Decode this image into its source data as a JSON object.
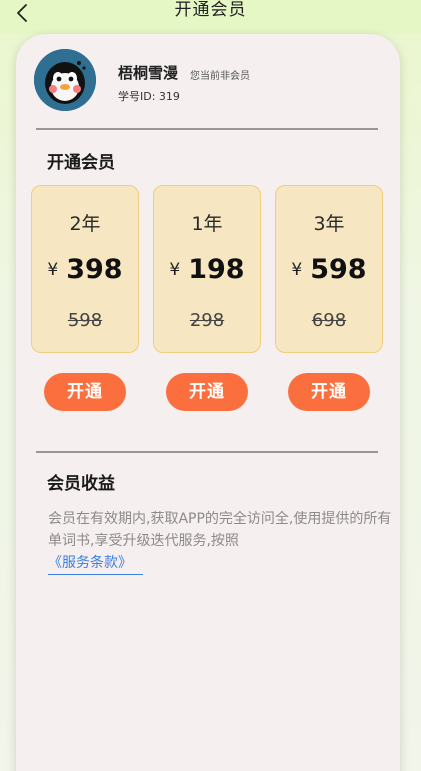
{
  "header": {
    "title": "开通会员",
    "back_icon": "chevron-left-icon"
  },
  "profile": {
    "username": "梧桐雪漫",
    "status": "您当前非会员",
    "student_id": "学号ID: 319",
    "avatar_icon": "penguin-avatar"
  },
  "plans_section": {
    "title": "开通会员",
    "currency": "¥",
    "plans": [
      {
        "duration": "2年",
        "price": "398",
        "original_price": "598",
        "button_label": "开通"
      },
      {
        "duration": "1年",
        "price": "198",
        "original_price": "298",
        "button_label": "开通"
      },
      {
        "duration": "3年",
        "price": "598",
        "original_price": "698",
        "button_label": "开通"
      }
    ]
  },
  "benefits": {
    "title": "会员收益",
    "description": "会员在有效期内,获取APP的完全访问全,使用提供的所有单词书,享受升级迭代服务,按照",
    "terms_link": "《服务条款》"
  },
  "colors": {
    "button": "#fb6f3e",
    "plan_card_bg": "#f7e6c2",
    "plan_card_border": "#f0cf7c",
    "link": "#3c7fe0",
    "header_bg": "#e6f7c6"
  }
}
